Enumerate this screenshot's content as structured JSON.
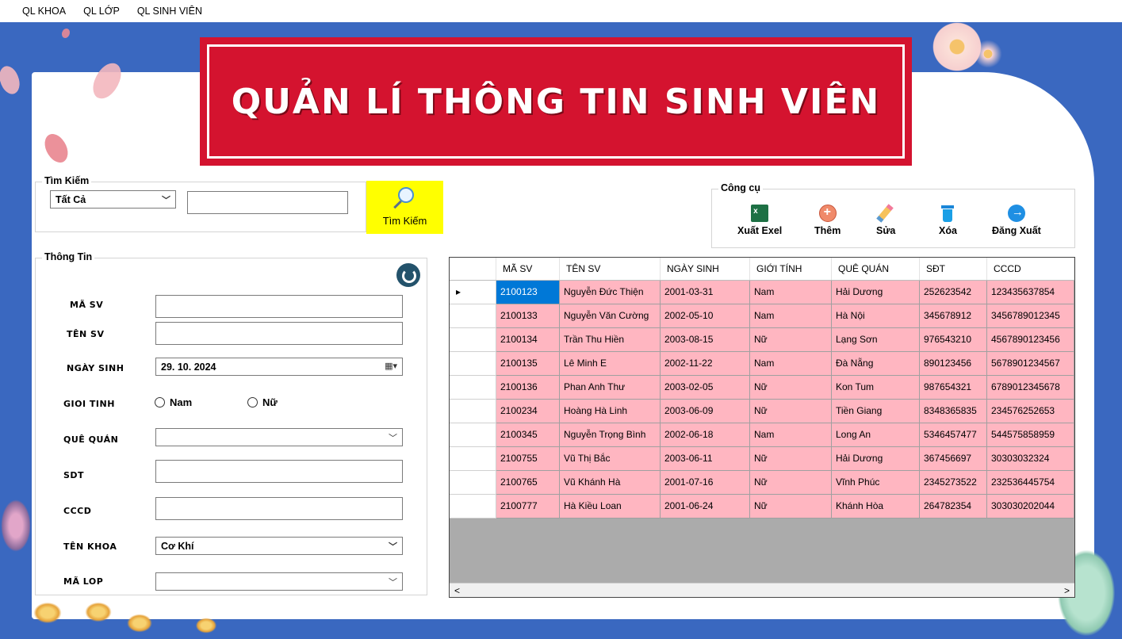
{
  "menu": [
    "QL KHOA",
    "QL LỚP",
    "QL SINH VIÊN"
  ],
  "banner": {
    "title": "QUẢN LÍ THÔNG TIN SINH VIÊN"
  },
  "search": {
    "group_label": "Tìm Kiếm",
    "filter_value": "Tất Cả",
    "query_value": "",
    "button_label": "Tìm Kiếm"
  },
  "tools": {
    "group_label": "Công cụ",
    "export": "Xuất Exel",
    "add": "Thêm",
    "edit": "Sửa",
    "delete": "Xóa",
    "logout": "Đăng Xuất"
  },
  "info": {
    "group_label": "Thông Tin",
    "ma_sv_label": "MÃ SV",
    "ten_sv_label": "TÊN SV",
    "ngay_sinh_label": "NGÀY SINH",
    "ngay_sinh_value": "29. 10. 2024",
    "gioi_tinh_label": "GIOI TINH",
    "gender_male": "Nam",
    "gender_female": "Nữ",
    "que_quan_label": "QUÊ QUÁN",
    "sdt_label": "SDT",
    "cccd_label": "CCCD",
    "ten_khoa_label": "TÊN KHOA",
    "ten_khoa_value": "Cơ Khí",
    "ma_lop_label": "MÃ LOP"
  },
  "table": {
    "headers": [
      "MÃ SV",
      "TÊN SV",
      "NGÀY SINH",
      "GIỚI TÍNH",
      "QUÊ QUÁN",
      "SĐT",
      "CCCD"
    ],
    "rows": [
      [
        "2100123",
        "Nguyễn Đức Thiện",
        "2001-03-31",
        "Nam",
        "Hải Dương",
        "252623542",
        "123435637854"
      ],
      [
        "2100133",
        "Nguyễn Văn Cường",
        "2002-05-10",
        "Nam",
        "Hà Nội",
        "345678912",
        "3456789012345"
      ],
      [
        "2100134",
        "Trần Thu Hiền",
        "2003-08-15",
        "Nữ",
        "Lạng Sơn",
        "976543210",
        "4567890123456"
      ],
      [
        "2100135",
        "Lê Minh E",
        "2002-11-22",
        "Nam",
        "Đà Nẵng",
        "890123456",
        "5678901234567"
      ],
      [
        "2100136",
        "Phan Anh Thư",
        "2003-02-05",
        "Nữ",
        "Kon Tum",
        "987654321",
        "6789012345678"
      ],
      [
        "2100234",
        "Hoàng Hà Linh",
        "2003-06-09",
        "Nữ",
        "Tiền Giang",
        "8348365835",
        "234576252653"
      ],
      [
        "2100345",
        "Nguyễn Trọng Bình",
        "2002-06-18",
        "Nam",
        "Long An",
        "5346457477",
        "544575858959"
      ],
      [
        "2100755",
        "Vũ Thị Bắc",
        "2003-06-11",
        "Nữ",
        "Hải Dương",
        "367456697",
        "30303032324"
      ],
      [
        "2100765",
        "Vũ Khánh Hà",
        "2001-07-16",
        "Nữ",
        "Vĩnh Phúc",
        "2345273522",
        "232536445754"
      ],
      [
        "2100777",
        "Hà Kiều Loan",
        "2001-06-24",
        "Nữ",
        "Khánh Hòa",
        "264782354",
        "303030202044"
      ]
    ]
  },
  "colors": {
    "frame": "#3a68c0",
    "banner": "#d4132f",
    "row": "#ffb6c1",
    "search_button": "#ffff00",
    "selection": "#0078d7"
  }
}
